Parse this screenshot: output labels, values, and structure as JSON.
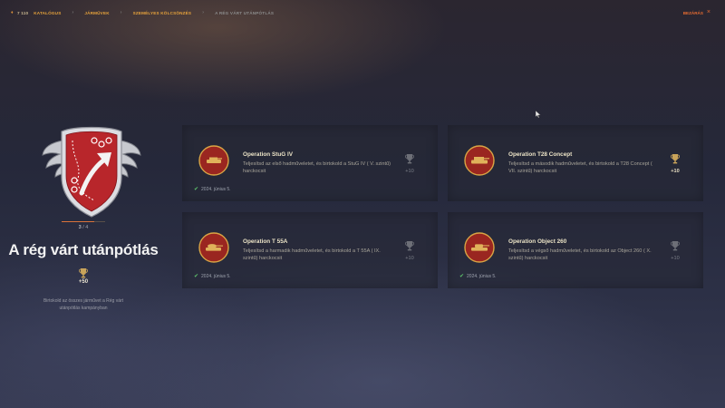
{
  "topbar": {
    "resource_count": "7 110",
    "breadcrumbs": [
      "Katalógus",
      "Járművek",
      "Személyes kölcsönzés"
    ],
    "current_crumb": "A rég várt utánpótlás",
    "back_label": "Bezárás"
  },
  "campaign": {
    "progress_current": "3",
    "progress_sep": " / ",
    "progress_total": "4",
    "progress_fraction": 0.75,
    "title": "A rég várt utánpótlás",
    "reward": "+50",
    "description": "Birtokold az összes járművet a Rég várt utánpótlás kampányban"
  },
  "operations": [
    {
      "title": "Operation StuG IV",
      "description": "Teljesítsd az első hadműveletet, és birtokold a StuG IV ( V. szintű) harckocsit",
      "date": "2024. június 5.",
      "reward": "+10",
      "completed": true
    },
    {
      "title": "Operation T28 Concept",
      "description": "Teljesítsd a második hadműveletet, és birtokold a T28 Concept ( VII. szintű) harckocsit",
      "date": "",
      "reward": "+10",
      "completed": false
    },
    {
      "title": "Operation T 55A",
      "description": "Teljesítsd a harmadik hadműveletet, és birtokold a T 55A ( IX. szintű) harckocsit",
      "date": "2024. június 5.",
      "reward": "+10",
      "completed": true
    },
    {
      "title": "Operation Object 260",
      "description": "Teljesítsd a végső hadműveletet, és birtokold az Object 260 ( X. szintű) harckocsit",
      "date": "2024. június 5.",
      "reward": "+10",
      "completed": true
    }
  ],
  "colors": {
    "accent": "#e8a33b",
    "close": "#e66b31",
    "badge_red": "#b8262b",
    "check_green": "#5dc36b"
  }
}
